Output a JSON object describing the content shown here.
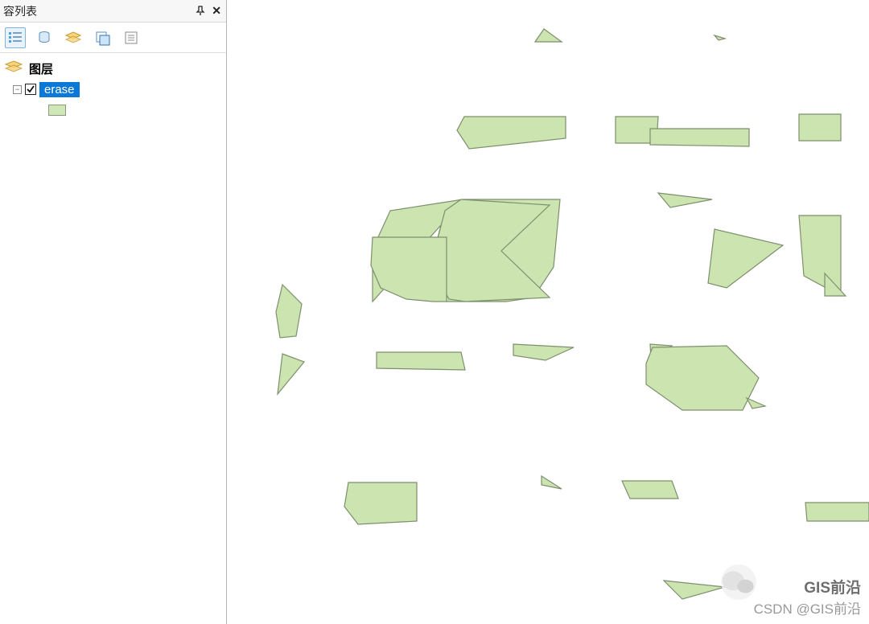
{
  "panel": {
    "title": "容列表",
    "pin_label": "⬏",
    "close_label": "✕"
  },
  "toolbar": {
    "btn1": "list-by-drawing-order-icon",
    "btn2": "list-by-source-icon",
    "btn3": "list-by-visibility-icon",
    "btn4": "list-by-selection-icon",
    "btn5": "options-icon"
  },
  "tree": {
    "root_label": "图层",
    "expander_symbol": "−",
    "layer_checked": true,
    "layer_name": "erase",
    "swatch_color": "#cbe4b0"
  },
  "watermark": {
    "line1": "GIS前沿",
    "line2": "CSDN @GIS前沿",
    "bubble": "♡"
  }
}
